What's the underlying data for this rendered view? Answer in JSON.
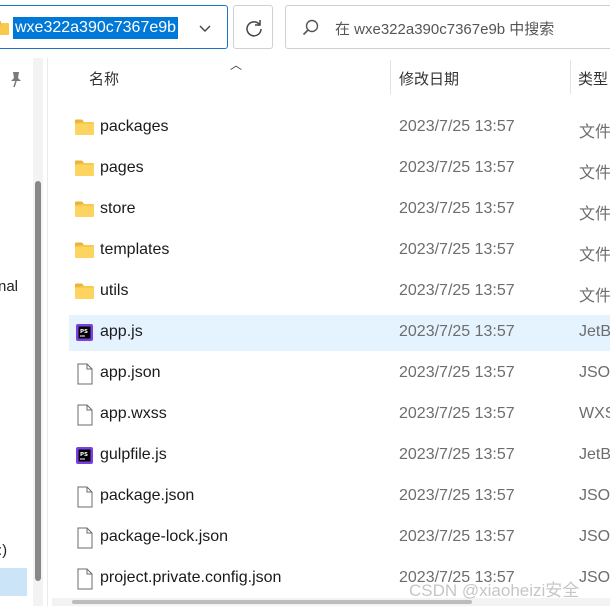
{
  "address_bar": {
    "path": "wxe322a390c7367e9b"
  },
  "search": {
    "placeholder": "在 wxe322a390c7367e9b 中搜索"
  },
  "nav": {
    "partial_labels": [
      "nal",
      ":)"
    ]
  },
  "columns": {
    "name": "名称",
    "date": "修改日期",
    "type": "类型"
  },
  "partial_row_fragments": [
    "~ ~",
    "~ ~"
  ],
  "files": [
    {
      "name": "packages",
      "date": "2023/7/25 13:57",
      "type": "文件",
      "icon": "folder-icon"
    },
    {
      "name": "pages",
      "date": "2023/7/25 13:57",
      "type": "文件",
      "icon": "folder-icon"
    },
    {
      "name": "store",
      "date": "2023/7/25 13:57",
      "type": "文件",
      "icon": "folder-icon"
    },
    {
      "name": "templates",
      "date": "2023/7/25 13:57",
      "type": "文件",
      "icon": "folder-icon"
    },
    {
      "name": "utils",
      "date": "2023/7/25 13:57",
      "type": "文件",
      "icon": "folder-icon"
    },
    {
      "name": "app.js",
      "date": "2023/7/25 13:57",
      "type": "JetB",
      "icon": "phpstorm-file-icon",
      "selected": true
    },
    {
      "name": "app.json",
      "date": "2023/7/25 13:57",
      "type": "JSON",
      "icon": "document-icon"
    },
    {
      "name": "app.wxss",
      "date": "2023/7/25 13:57",
      "type": "WXS",
      "icon": "document-icon"
    },
    {
      "name": "gulpfile.js",
      "date": "2023/7/25 13:57",
      "type": "JetB",
      "icon": "phpstorm-file-icon"
    },
    {
      "name": "package.json",
      "date": "2023/7/25 13:57",
      "type": "JSON",
      "icon": "document-icon"
    },
    {
      "name": "package-lock.json",
      "date": "2023/7/25 13:57",
      "type": "JSON",
      "icon": "document-icon"
    },
    {
      "name": "project.private.config.json",
      "date": "2023/7/25 13:57",
      "type": "JSON",
      "icon": "document-icon"
    }
  ],
  "watermark": "CSDN @xiaoheizi安全",
  "colors": {
    "selection_blue": "#0078d7",
    "row_selected": "#e5f3ff",
    "folder_yellow": "#f8c94a"
  }
}
